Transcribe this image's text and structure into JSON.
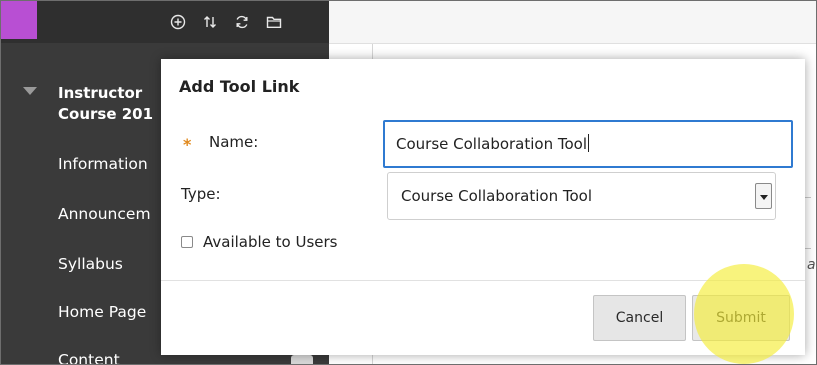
{
  "toolbar": {
    "icons": [
      "add-circle-icon",
      "reorder-arrows-icon",
      "refresh-icon",
      "folder-icon"
    ]
  },
  "sidebar": {
    "course_title_line1": "Instructor",
    "course_title_line2": "Course 201",
    "items": [
      {
        "label": "Information"
      },
      {
        "label": "Announcem"
      },
      {
        "label": "Syllabus"
      },
      {
        "label": "Home Page"
      },
      {
        "label": "Content"
      }
    ]
  },
  "page": {
    "fragment": "a"
  },
  "dialog": {
    "title": "Add Tool Link",
    "name_label": "Name:",
    "required_marker": "*",
    "name_value": "Course Collaboration Tool",
    "type_label": "Type:",
    "type_value": "Course Collaboration Tool",
    "available_label": "Available to Users",
    "available_checked": false,
    "cancel_label": "Cancel",
    "submit_label": "Submit"
  },
  "colors": {
    "accent": "#b84fd3",
    "focus": "#2f7ad1",
    "required": "#e0891d",
    "highlight": "#f5ec38"
  }
}
